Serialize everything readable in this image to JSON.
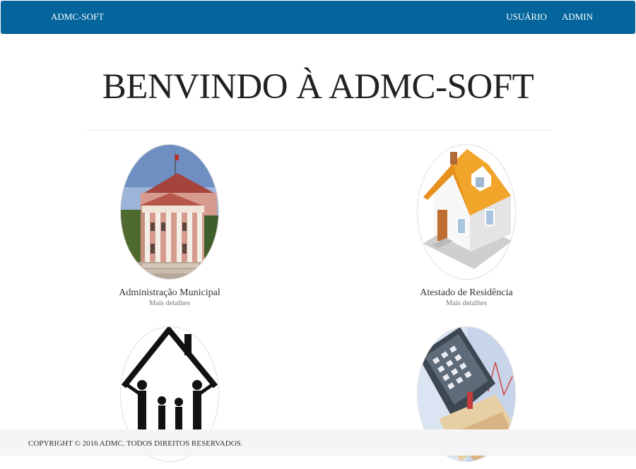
{
  "navbar": {
    "brand": "ADMC-SOFT",
    "links": [
      "USUÁRIO",
      "ADMIN"
    ],
    "background": "#03659c"
  },
  "main": {
    "title": "BENVINDO À ADMC-SOFT",
    "cards": [
      {
        "title": "Administração Municipal",
        "link": "Mais detalhes",
        "icon": "municipal-building-photo"
      },
      {
        "title": "Atestado de Residência",
        "link": "Mais detalhes",
        "icon": "house-icon"
      },
      {
        "title": "",
        "link": "",
        "icon": "family-house-icon"
      },
      {
        "title": "",
        "link": "",
        "icon": "calculator-money-photo"
      }
    ]
  },
  "footer": {
    "text": "COPYRIGHT © 2016 ADMC. TODOS DIREITOS RESERVADOS."
  }
}
